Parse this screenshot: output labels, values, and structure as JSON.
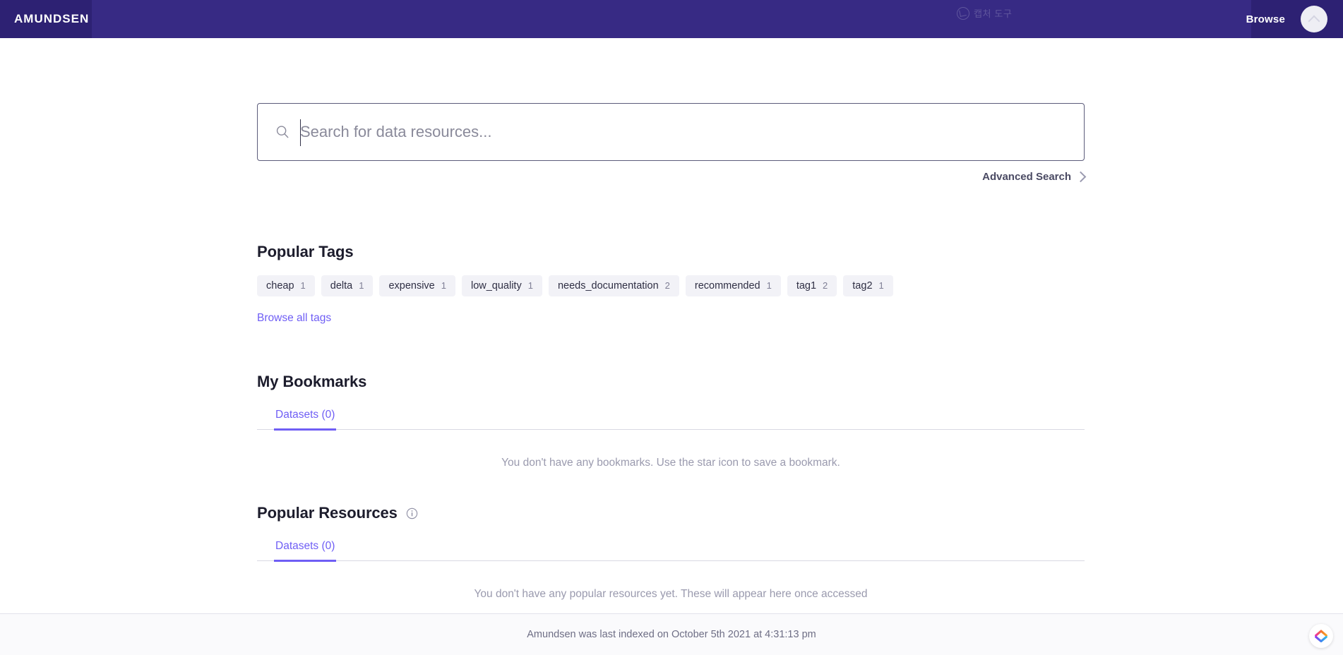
{
  "navbar": {
    "brand": "AMUNDSEN",
    "browse_label": "Browse",
    "capture_tool_label": "캡처 도구",
    "avatar_name": "user-avatar",
    "bg_color": "#2d2173",
    "inner_color": "#372a84"
  },
  "search": {
    "placeholder": "Search for data resources...",
    "value": "",
    "advanced_label": "Advanced Search"
  },
  "popular_tags": {
    "title": "Popular Tags",
    "browse_all_label": "Browse all tags",
    "tags": [
      {
        "name": "cheap",
        "count": "1"
      },
      {
        "name": "delta",
        "count": "1"
      },
      {
        "name": "expensive",
        "count": "1"
      },
      {
        "name": "low_quality",
        "count": "1"
      },
      {
        "name": "needs_documentation",
        "count": "2"
      },
      {
        "name": "recommended",
        "count": "1"
      },
      {
        "name": "tag1",
        "count": "2"
      },
      {
        "name": "tag2",
        "count": "1"
      }
    ]
  },
  "bookmarks": {
    "title": "My Bookmarks",
    "tab_label": "Datasets (0)",
    "empty_message": "You don't have any bookmarks. Use the star icon to save a bookmark."
  },
  "popular_resources": {
    "title": "Popular Resources",
    "info_icon": "info-circle-icon",
    "tab_label": "Datasets (0)",
    "empty_message": "You don't have any popular resources yet. These will appear here once accessed"
  },
  "footer": {
    "text": "Amundsen was last indexed on October 5th 2021 at 4:31:13 pm"
  },
  "colors": {
    "brand_purple": "#2d2173",
    "accent_purple": "#6f5ef5",
    "tag_bg": "#f2f2f7",
    "muted_text": "#9a9aae"
  }
}
